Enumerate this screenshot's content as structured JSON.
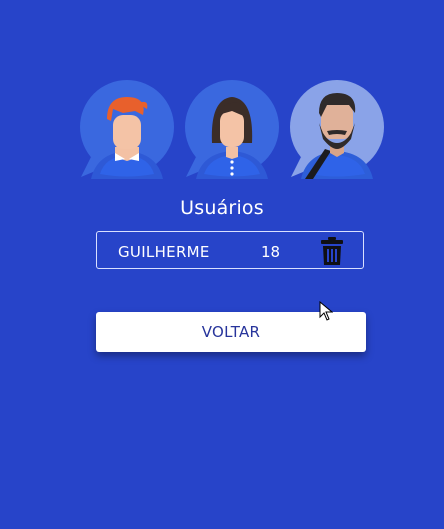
{
  "header": {
    "title": "Usuários"
  },
  "avatars": [
    {
      "icon": "avatar-red-hair-icon",
      "accent": "#e8602c"
    },
    {
      "icon": "avatar-dark-hair-icon",
      "accent": "#3b2d28"
    },
    {
      "icon": "avatar-bearded-icon",
      "accent": "#2f2a2a"
    }
  ],
  "users": [
    {
      "name": "GUILHERME",
      "age": "18",
      "delete_icon": "trash-icon"
    }
  ],
  "actions": {
    "back_label": "VOLTAR"
  },
  "colors": {
    "background": "#2744c9",
    "button_bg": "#ffffff",
    "button_text": "#27349b"
  }
}
